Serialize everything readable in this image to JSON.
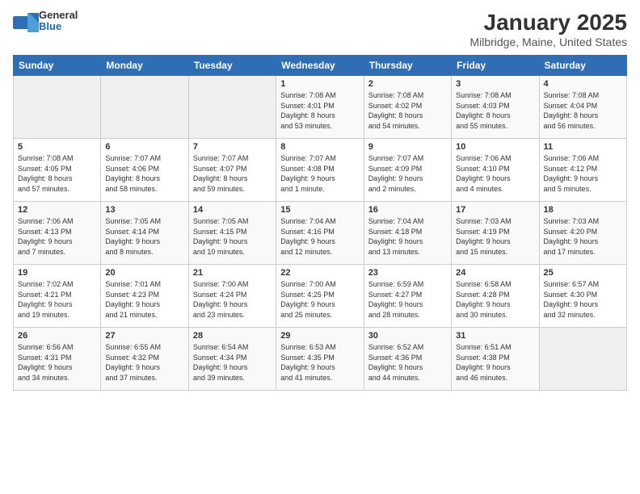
{
  "header": {
    "logo": {
      "general": "General",
      "blue": "Blue"
    },
    "title": "January 2025",
    "location": "Milbridge, Maine, United States"
  },
  "weekdays": [
    "Sunday",
    "Monday",
    "Tuesday",
    "Wednesday",
    "Thursday",
    "Friday",
    "Saturday"
  ],
  "weeks": [
    [
      {
        "day": "",
        "info": ""
      },
      {
        "day": "",
        "info": ""
      },
      {
        "day": "",
        "info": ""
      },
      {
        "day": "1",
        "info": "Sunrise: 7:08 AM\nSunset: 4:01 PM\nDaylight: 8 hours\nand 53 minutes."
      },
      {
        "day": "2",
        "info": "Sunrise: 7:08 AM\nSunset: 4:02 PM\nDaylight: 8 hours\nand 54 minutes."
      },
      {
        "day": "3",
        "info": "Sunrise: 7:08 AM\nSunset: 4:03 PM\nDaylight: 8 hours\nand 55 minutes."
      },
      {
        "day": "4",
        "info": "Sunrise: 7:08 AM\nSunset: 4:04 PM\nDaylight: 8 hours\nand 56 minutes."
      }
    ],
    [
      {
        "day": "5",
        "info": "Sunrise: 7:08 AM\nSunset: 4:05 PM\nDaylight: 8 hours\nand 57 minutes."
      },
      {
        "day": "6",
        "info": "Sunrise: 7:07 AM\nSunset: 4:06 PM\nDaylight: 8 hours\nand 58 minutes."
      },
      {
        "day": "7",
        "info": "Sunrise: 7:07 AM\nSunset: 4:07 PM\nDaylight: 8 hours\nand 59 minutes."
      },
      {
        "day": "8",
        "info": "Sunrise: 7:07 AM\nSunset: 4:08 PM\nDaylight: 9 hours\nand 1 minute."
      },
      {
        "day": "9",
        "info": "Sunrise: 7:07 AM\nSunset: 4:09 PM\nDaylight: 9 hours\nand 2 minutes."
      },
      {
        "day": "10",
        "info": "Sunrise: 7:06 AM\nSunset: 4:10 PM\nDaylight: 9 hours\nand 4 minutes."
      },
      {
        "day": "11",
        "info": "Sunrise: 7:06 AM\nSunset: 4:12 PM\nDaylight: 9 hours\nand 5 minutes."
      }
    ],
    [
      {
        "day": "12",
        "info": "Sunrise: 7:06 AM\nSunset: 4:13 PM\nDaylight: 9 hours\nand 7 minutes."
      },
      {
        "day": "13",
        "info": "Sunrise: 7:05 AM\nSunset: 4:14 PM\nDaylight: 9 hours\nand 8 minutes."
      },
      {
        "day": "14",
        "info": "Sunrise: 7:05 AM\nSunset: 4:15 PM\nDaylight: 9 hours\nand 10 minutes."
      },
      {
        "day": "15",
        "info": "Sunrise: 7:04 AM\nSunset: 4:16 PM\nDaylight: 9 hours\nand 12 minutes."
      },
      {
        "day": "16",
        "info": "Sunrise: 7:04 AM\nSunset: 4:18 PM\nDaylight: 9 hours\nand 13 minutes."
      },
      {
        "day": "17",
        "info": "Sunrise: 7:03 AM\nSunset: 4:19 PM\nDaylight: 9 hours\nand 15 minutes."
      },
      {
        "day": "18",
        "info": "Sunrise: 7:03 AM\nSunset: 4:20 PM\nDaylight: 9 hours\nand 17 minutes."
      }
    ],
    [
      {
        "day": "19",
        "info": "Sunrise: 7:02 AM\nSunset: 4:21 PM\nDaylight: 9 hours\nand 19 minutes."
      },
      {
        "day": "20",
        "info": "Sunrise: 7:01 AM\nSunset: 4:23 PM\nDaylight: 9 hours\nand 21 minutes."
      },
      {
        "day": "21",
        "info": "Sunrise: 7:00 AM\nSunset: 4:24 PM\nDaylight: 9 hours\nand 23 minutes."
      },
      {
        "day": "22",
        "info": "Sunrise: 7:00 AM\nSunset: 4:25 PM\nDaylight: 9 hours\nand 25 minutes."
      },
      {
        "day": "23",
        "info": "Sunrise: 6:59 AM\nSunset: 4:27 PM\nDaylight: 9 hours\nand 28 minutes."
      },
      {
        "day": "24",
        "info": "Sunrise: 6:58 AM\nSunset: 4:28 PM\nDaylight: 9 hours\nand 30 minutes."
      },
      {
        "day": "25",
        "info": "Sunrise: 6:57 AM\nSunset: 4:30 PM\nDaylight: 9 hours\nand 32 minutes."
      }
    ],
    [
      {
        "day": "26",
        "info": "Sunrise: 6:56 AM\nSunset: 4:31 PM\nDaylight: 9 hours\nand 34 minutes."
      },
      {
        "day": "27",
        "info": "Sunrise: 6:55 AM\nSunset: 4:32 PM\nDaylight: 9 hours\nand 37 minutes."
      },
      {
        "day": "28",
        "info": "Sunrise: 6:54 AM\nSunset: 4:34 PM\nDaylight: 9 hours\nand 39 minutes."
      },
      {
        "day": "29",
        "info": "Sunrise: 6:53 AM\nSunset: 4:35 PM\nDaylight: 9 hours\nand 41 minutes."
      },
      {
        "day": "30",
        "info": "Sunrise: 6:52 AM\nSunset: 4:36 PM\nDaylight: 9 hours\nand 44 minutes."
      },
      {
        "day": "31",
        "info": "Sunrise: 6:51 AM\nSunset: 4:38 PM\nDaylight: 9 hours\nand 46 minutes."
      },
      {
        "day": "",
        "info": ""
      }
    ]
  ]
}
